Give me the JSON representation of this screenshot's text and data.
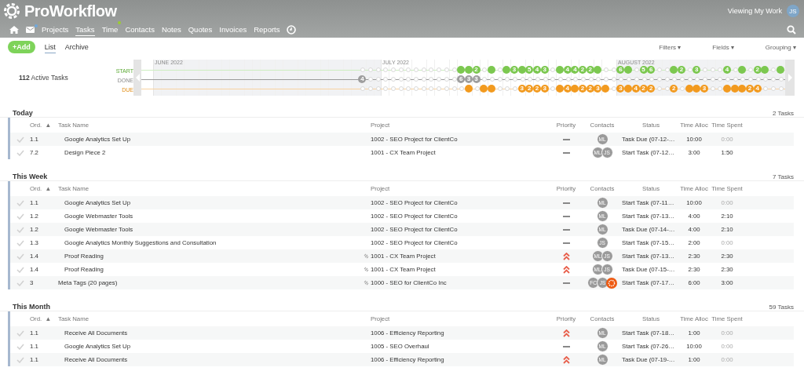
{
  "app": {
    "name": "ProWorkflow",
    "viewing": "Viewing My Work",
    "user_initials": "JS"
  },
  "nav": {
    "mail_badge": {
      "on": true,
      "color": "#6fa8dc"
    },
    "items": [
      {
        "label": "Projects",
        "selected": false
      },
      {
        "label": "Tasks",
        "selected": true
      },
      {
        "label": "Time",
        "selected": false,
        "badge": {
          "on": true,
          "color": "#9acd32"
        }
      },
      {
        "label": "Contacts",
        "selected": false
      },
      {
        "label": "Notes",
        "selected": false
      },
      {
        "label": "Quotes",
        "selected": false
      },
      {
        "label": "Invoices",
        "selected": false
      },
      {
        "label": "Reports",
        "selected": false
      }
    ]
  },
  "toolbar": {
    "add": "+Add",
    "views": [
      {
        "label": "List",
        "selected": true
      },
      {
        "label": "Archive",
        "selected": false
      }
    ],
    "menus": [
      {
        "label": "Filters",
        "caret": "▾"
      },
      {
        "label": "Fields",
        "caret": "▾"
      },
      {
        "label": "Grouping",
        "caret": "▾"
      }
    ]
  },
  "timeline": {
    "count": "112",
    "count_label": "Active Tasks",
    "months": [
      {
        "label": "JUNE 2022",
        "shaded": true
      },
      {
        "label": "JULY 2022",
        "shaded": false
      },
      {
        "label": "AUGUST 2022",
        "shaded": true
      }
    ],
    "rows": [
      {
        "label": "START",
        "kind": "start",
        "cells": [
          {
            "dot": false
          },
          {
            "dot": false
          },
          {
            "dot": false
          },
          {
            "dot": false
          },
          {
            "dot": false
          },
          {
            "dot": false
          },
          {
            "dot": false
          },
          {
            "dot": false
          },
          {
            "dot": false
          },
          {
            "dot": false
          },
          {
            "dot": false
          },
          {
            "dot": false
          },
          {
            "dot": false
          },
          {
            "dot": true
          },
          {
            "dot": true
          },
          {
            "dot": true,
            "label": "2"
          },
          {
            "dot": false
          },
          {
            "dot": true
          },
          {
            "dot": false
          },
          {
            "dot": true
          },
          {
            "dot": true,
            "label": "3"
          },
          {
            "dot": true
          },
          {
            "dot": true,
            "label": "5"
          },
          {
            "dot": true,
            "label": "4"
          },
          {
            "dot": true,
            "label": "3"
          },
          {
            "dot": false
          },
          {
            "dot": true
          },
          {
            "dot": true,
            "label": "4"
          },
          {
            "dot": true,
            "label": "4"
          },
          {
            "dot": true,
            "label": "2"
          },
          {
            "dot": true,
            "label": "2"
          },
          {
            "dot": true
          },
          {
            "dot": false
          },
          {
            "dot": false
          },
          {
            "dot": true,
            "label": "6"
          },
          {
            "dot": true
          },
          {
            "dot": false
          },
          {
            "dot": true,
            "label": "5"
          },
          {
            "dot": true,
            "label": "6"
          },
          {
            "dot": false
          },
          {
            "dot": false
          },
          {
            "dot": true
          },
          {
            "dot": true,
            "label": "2"
          },
          {
            "dot": false
          },
          {
            "dot": true,
            "label": "3"
          },
          {
            "dot": false
          },
          {
            "dot": false
          },
          {
            "dot": false
          },
          {
            "dot": true,
            "label": "4"
          },
          {
            "dot": false
          },
          {
            "dot": true
          },
          {
            "dot": false
          },
          {
            "dot": true,
            "label": "2"
          },
          {
            "dot": true
          },
          {
            "dot": false
          },
          {
            "dot": true
          }
        ]
      },
      {
        "label": "DONE",
        "kind": "done",
        "cells": [
          {
            "dot": true,
            "label": "4"
          },
          {
            "dot": false
          },
          {
            "dot": false
          },
          {
            "dot": false
          },
          {
            "dot": false
          },
          {
            "dot": false
          },
          {
            "dot": false
          },
          {
            "dot": false
          },
          {
            "dot": false
          },
          {
            "dot": false
          },
          {
            "dot": false
          },
          {
            "dot": false
          },
          {
            "dot": false
          },
          {
            "dot": true,
            "label": "6"
          },
          {
            "dot": true,
            "label": "3"
          },
          {
            "dot": true,
            "label": "3"
          },
          {
            "dot": false
          },
          {
            "dot": false
          },
          {
            "dot": false
          },
          {
            "dot": false
          },
          {
            "dot": false
          },
          {
            "dot": false
          },
          {
            "dot": false
          },
          {
            "dot": false
          },
          {
            "dot": false
          },
          {
            "dot": false
          },
          {
            "dot": false
          },
          {
            "dot": false
          },
          {
            "dot": false
          },
          {
            "dot": false
          },
          {
            "dot": false
          },
          {
            "dot": false
          },
          {
            "dot": false
          },
          {
            "dot": false
          },
          {
            "dot": false
          },
          {
            "dot": false
          },
          {
            "dot": false
          },
          {
            "dot": false
          },
          {
            "dot": false
          },
          {
            "dot": false
          },
          {
            "dot": false
          },
          {
            "dot": false
          },
          {
            "dot": false
          },
          {
            "dot": false
          },
          {
            "dot": false
          },
          {
            "dot": false
          },
          {
            "dot": false
          },
          {
            "dot": false
          },
          {
            "dot": false
          },
          {
            "dot": false
          },
          {
            "dot": false
          },
          {
            "dot": false
          },
          {
            "dot": false
          },
          {
            "dot": false
          },
          {
            "dot": false
          },
          {
            "dot": false
          }
        ]
      },
      {
        "label": "DUE",
        "kind": "due",
        "cells": [
          {
            "dot": false
          },
          {
            "dot": false
          },
          {
            "dot": false
          },
          {
            "dot": false
          },
          {
            "dot": false
          },
          {
            "dot": false
          },
          {
            "dot": false
          },
          {
            "dot": false
          },
          {
            "dot": false
          },
          {
            "dot": false
          },
          {
            "dot": false
          },
          {
            "dot": false
          },
          {
            "dot": false
          },
          {
            "dot": false
          },
          {
            "dot": true
          },
          {
            "dot": false
          },
          {
            "dot": true
          },
          {
            "dot": true
          },
          {
            "dot": false
          },
          {
            "dot": false
          },
          {
            "dot": false
          },
          {
            "dot": true,
            "label": "3"
          },
          {
            "dot": true,
            "label": "2"
          },
          {
            "dot": true,
            "label": "2"
          },
          {
            "dot": true,
            "label": "3"
          },
          {
            "dot": false
          },
          {
            "dot": true
          },
          {
            "dot": true,
            "label": "4"
          },
          {
            "dot": true
          },
          {
            "dot": true,
            "label": "2"
          },
          {
            "dot": true,
            "label": "2"
          },
          {
            "dot": true,
            "label": "3"
          },
          {
            "dot": true
          },
          {
            "dot": false
          },
          {
            "dot": true,
            "label": "3"
          },
          {
            "dot": true
          },
          {
            "dot": true,
            "label": "4"
          },
          {
            "dot": true,
            "label": "2"
          },
          {
            "dot": true,
            "label": "2"
          },
          {
            "dot": false
          },
          {
            "dot": false
          },
          {
            "dot": true,
            "label": "2"
          },
          {
            "dot": false
          },
          {
            "dot": true
          },
          {
            "dot": true
          },
          {
            "dot": true,
            "label": "3"
          },
          {
            "dot": false
          },
          {
            "dot": false
          },
          {
            "dot": true
          },
          {
            "dot": true
          },
          {
            "dot": true
          },
          {
            "dot": true,
            "label": "2"
          },
          {
            "dot": true,
            "label": "4"
          },
          {
            "dot": false
          },
          {
            "dot": false
          },
          {
            "dot": false
          }
        ]
      }
    ]
  },
  "sections": [
    {
      "title": "Today",
      "count": "2 Tasks",
      "columns": [
        {
          "label": "Ord.",
          "sort": "▲"
        },
        {
          "label": "Task Name"
        },
        {
          "label": "Project"
        },
        {
          "label": "Priority"
        },
        {
          "label": "Contacts"
        },
        {
          "label": "Status"
        },
        {
          "label": "Time Alloc"
        },
        {
          "label": "Time Spent"
        }
      ],
      "rows": [
        {
          "ord": "1.1",
          "task": "Google Analytics Set Up",
          "subtask": true,
          "linked": false,
          "project": "1002 - SEO Project for ClientCo",
          "high_priority": false,
          "contacts": [
            {
              "kind": "person",
              "initials": "ML"
            }
          ],
          "status": "Task Due (07-12-…",
          "alloc": "10:00",
          "spent": "0:00",
          "spent_dim": true
        },
        {
          "ord": "7.2",
          "task": "Design Piece 2",
          "subtask": true,
          "linked": false,
          "project": "1001 - CX Team Project",
          "high_priority": false,
          "contacts": [
            {
              "kind": "person",
              "initials": "ML"
            },
            {
              "kind": "person",
              "initials": "JS"
            }
          ],
          "status": "Start Task (07-12…",
          "alloc": "3:00",
          "spent": "1:50",
          "spent_dim": false
        }
      ]
    },
    {
      "title": "This Week",
      "count": "7 Tasks",
      "columns": [
        {
          "label": "Ord.",
          "sort": "▲"
        },
        {
          "label": "Task Name"
        },
        {
          "label": "Project"
        },
        {
          "label": "Priority"
        },
        {
          "label": "Contacts"
        },
        {
          "label": "Status"
        },
        {
          "label": "Time Alloc"
        },
        {
          "label": "Time Spent"
        }
      ],
      "rows": [
        {
          "ord": "1.1",
          "task": "Google Analytics Set Up",
          "subtask": true,
          "linked": false,
          "project": "1002 - SEO Project for ClientCo",
          "high_priority": false,
          "contacts": [
            {
              "kind": "person",
              "initials": "ML"
            }
          ],
          "status": "Start Task (07-11…",
          "alloc": "10:00",
          "spent": "0:00",
          "spent_dim": true
        },
        {
          "ord": "1.2",
          "task": "Google Webmaster Tools",
          "subtask": true,
          "linked": false,
          "project": "1002 - SEO Project for ClientCo",
          "high_priority": false,
          "contacts": [
            {
              "kind": "person",
              "initials": "ML"
            }
          ],
          "status": "Start Task (07-13…",
          "alloc": "4:00",
          "spent": "2:10",
          "spent_dim": false
        },
        {
          "ord": "1.2",
          "task": "Google Webmaster Tools",
          "subtask": true,
          "linked": false,
          "project": "1002 - SEO Project for ClientCo",
          "high_priority": false,
          "contacts": [
            {
              "kind": "person",
              "initials": "ML"
            }
          ],
          "status": "Task Due (07-14-…",
          "alloc": "4:00",
          "spent": "2:10",
          "spent_dim": false
        },
        {
          "ord": "1.3",
          "task": "Google Analytics Monthly Suggestions and Consultation",
          "subtask": true,
          "linked": false,
          "project": "1002 - SEO Project for ClientCo",
          "high_priority": false,
          "contacts": [
            {
              "kind": "person",
              "initials": "JS"
            }
          ],
          "status": "Start Task (07-15…",
          "alloc": "2:00",
          "spent": "0:00",
          "spent_dim": true
        },
        {
          "ord": "1.4",
          "task": "Proof Reading",
          "subtask": true,
          "linked": true,
          "project": "1001 - CX Team Project",
          "high_priority": true,
          "contacts": [
            {
              "kind": "person",
              "initials": "ML"
            },
            {
              "kind": "person",
              "initials": "JS"
            }
          ],
          "status": "Start Task (07-13…",
          "alloc": "2:30",
          "spent": "2:30",
          "spent_dim": false
        },
        {
          "ord": "1.4",
          "task": "Proof Reading",
          "subtask": true,
          "linked": true,
          "project": "1001 - CX Team Project",
          "high_priority": true,
          "contacts": [
            {
              "kind": "person",
              "initials": "ML"
            },
            {
              "kind": "person",
              "initials": "JS"
            }
          ],
          "status": "Task Due (07-15-…",
          "alloc": "2:30",
          "spent": "2:30",
          "spent_dim": false
        },
        {
          "ord": "3",
          "task": "Meta Tags (20 pages)",
          "subtask": false,
          "linked": true,
          "project": "1000 - SEO for ClientCo Inc",
          "high_priority": false,
          "contacts": [
            {
              "kind": "person",
              "initials": "FC"
            },
            {
              "kind": "person",
              "initials": "JS"
            },
            {
              "kind": "logo"
            }
          ],
          "status": "Start Task (07-17…",
          "alloc": "6:00",
          "spent": "3:00",
          "spent_dim": false
        }
      ]
    },
    {
      "title": "This Month",
      "count": "59 Tasks",
      "columns": [
        {
          "label": "Ord.",
          "sort": "▲"
        },
        {
          "label": "Task Name"
        },
        {
          "label": "Project"
        },
        {
          "label": "Priority"
        },
        {
          "label": "Contacts"
        },
        {
          "label": "Status"
        },
        {
          "label": "Time Alloc"
        },
        {
          "label": "Time Spent"
        }
      ],
      "rows": [
        {
          "ord": "1.1",
          "task": "Receive All Documents",
          "subtask": true,
          "linked": false,
          "project": "1006 - Efficiency Reporting",
          "high_priority": true,
          "contacts": [
            {
              "kind": "person",
              "initials": "ML"
            }
          ],
          "status": "Start Task (07-18…",
          "alloc": "1:00",
          "spent": "0:00",
          "spent_dim": true
        },
        {
          "ord": "1.1",
          "task": "Google Analytics Set Up",
          "subtask": true,
          "linked": false,
          "project": "1005 - SEO Overhaul",
          "high_priority": false,
          "contacts": [
            {
              "kind": "person",
              "initials": "ML"
            }
          ],
          "status": "Start Task (07-26…",
          "alloc": "10:00",
          "spent": "0:00",
          "spent_dim": true
        },
        {
          "ord": "1.1",
          "task": "Receive All Documents",
          "subtask": true,
          "linked": false,
          "project": "1006 - Efficiency Reporting",
          "high_priority": true,
          "contacts": [
            {
              "kind": "person",
              "initials": "ML"
            }
          ],
          "status": "Task Due (07-19-…",
          "alloc": "1:00",
          "spent": "0:00",
          "spent_dim": true
        }
      ]
    }
  ]
}
